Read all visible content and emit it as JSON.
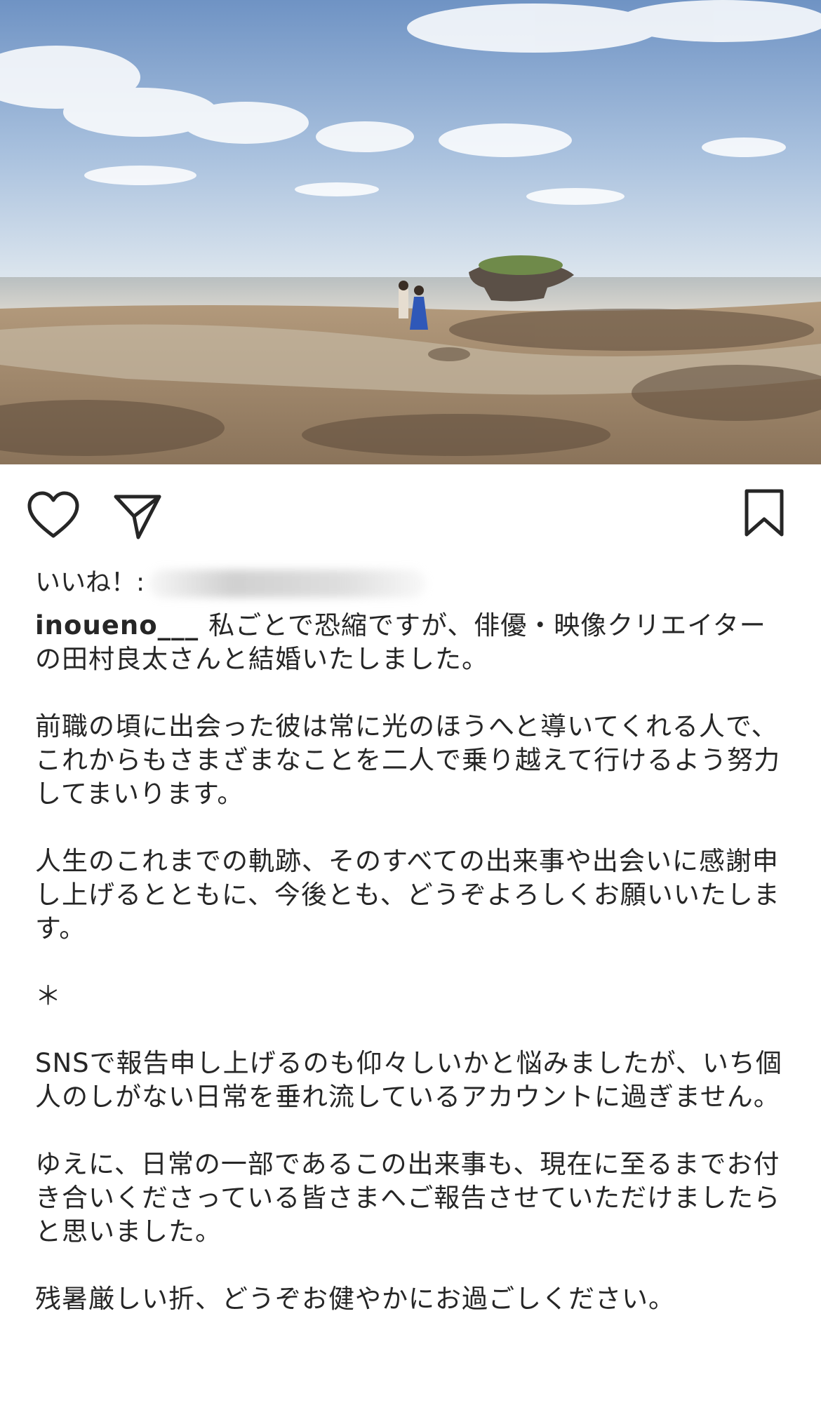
{
  "post": {
    "username": "inoueno___",
    "likes_prefix": "いいね！:",
    "caption_paragraphs": [
      "私ごとで恐縮ですが、俳優・映像クリエイターの田村良太さんと結婚いたしました。",
      "前職の頃に出会った彼は常に光のほうへと導いてくれる人で、これからもさまざまなことを二人で乗り越えて行けるよう努力してまいります。",
      "人生のこれまでの軌跡、そのすべての出来事や出会いに感謝申し上げるとともに、今後とも、どうぞよろしくお願いいたします。",
      "＊",
      "SNSで報告申し上げるのも仰々しいかと悩みましたが、いち個人のしがない日常を垂れ流しているアカウントに過ぎません。",
      "ゆえに、日常の一部であるこの出来事も、現在に至るまでお付き合いくださっている皆さまへご報告させていただけましたらと思いました。",
      "残暑厳しい折、どうぞお健やかにお過ごしください。"
    ]
  },
  "icons": {
    "like": "heart-icon",
    "share": "send-icon",
    "save": "bookmark-icon"
  },
  "colors": {
    "text": "#262626",
    "background": "#ffffff"
  }
}
